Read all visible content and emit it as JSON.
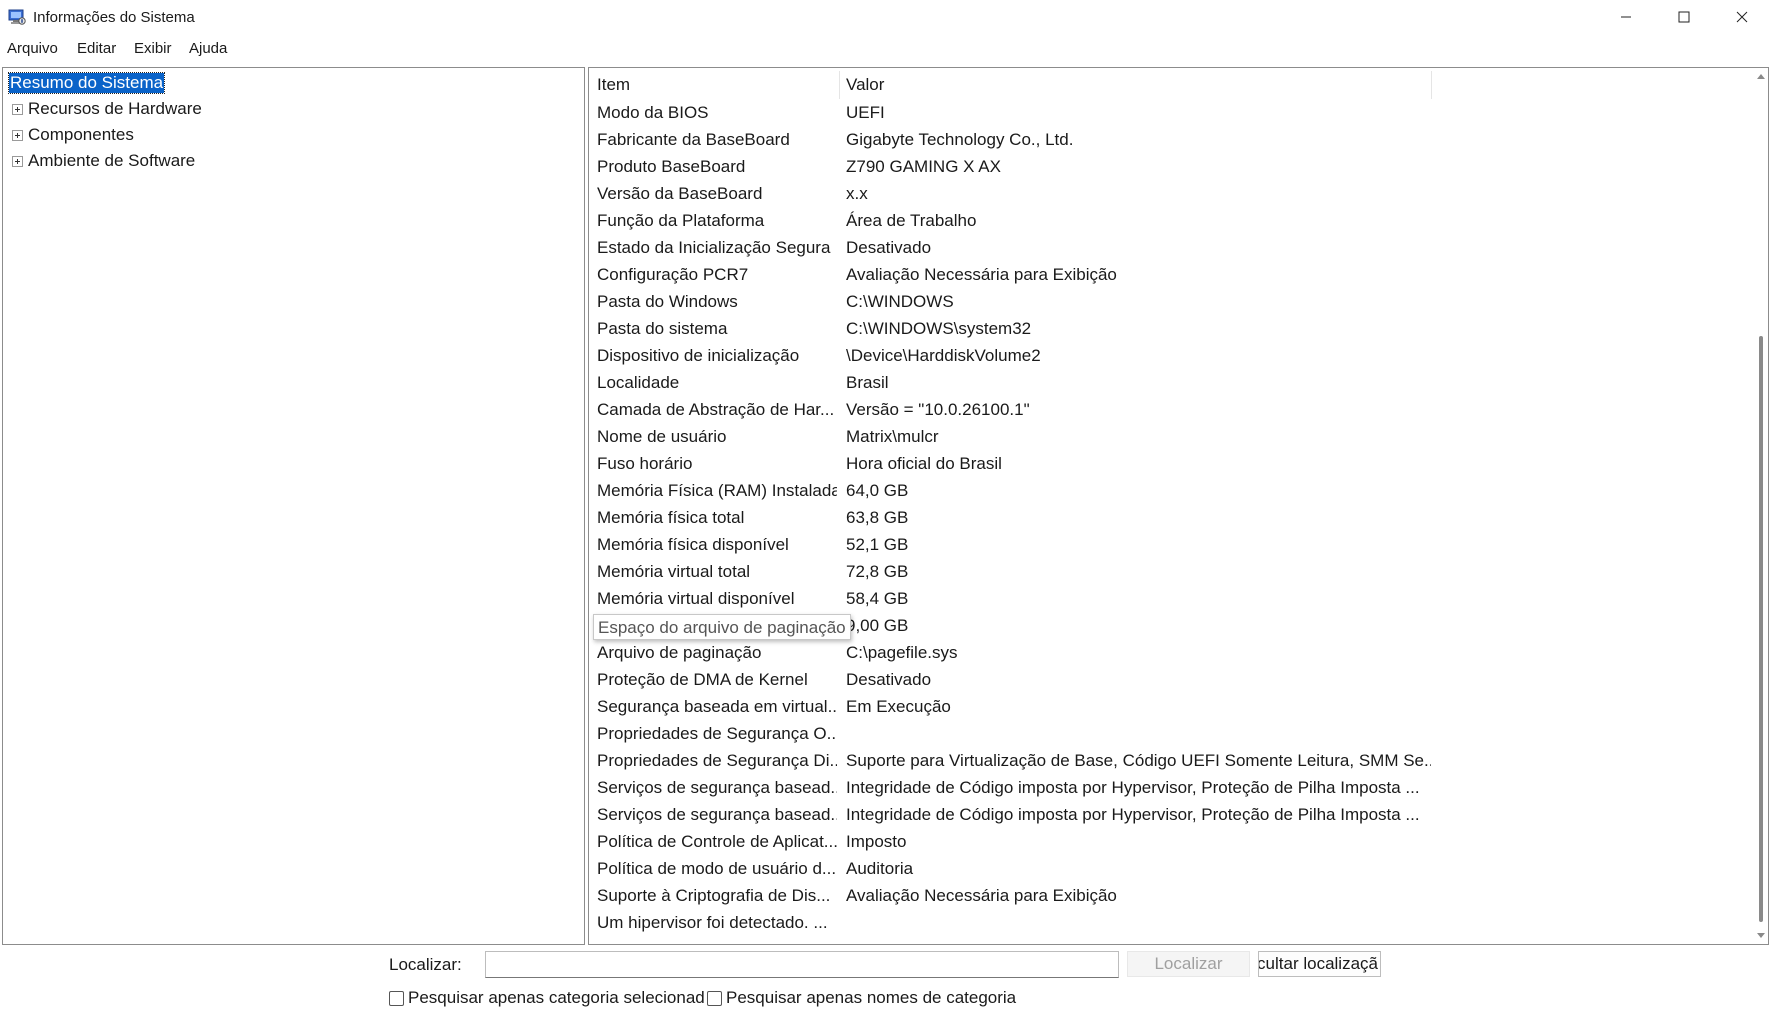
{
  "window": {
    "title": "Informações do Sistema",
    "icon": "system-info-icon"
  },
  "menu": [
    "Arquivo",
    "Editar",
    "Exibir",
    "Ajuda"
  ],
  "tree": {
    "selected": "Resumo do Sistema",
    "nodes": [
      "Recursos de Hardware",
      "Componentes",
      "Ambiente de Software"
    ]
  },
  "list": {
    "headers": {
      "item": "Item",
      "value": "Valor"
    },
    "rows": [
      {
        "item": "Modo da BIOS",
        "value": "UEFI"
      },
      {
        "item": "Fabricante da BaseBoard",
        "value": "Gigabyte Technology Co., Ltd."
      },
      {
        "item": "Produto BaseBoard",
        "value": "Z790 GAMING X AX"
      },
      {
        "item": "Versão da BaseBoard",
        "value": "x.x"
      },
      {
        "item": "Função da Plataforma",
        "value": "Área de Trabalho"
      },
      {
        "item": "Estado da Inicialização Segura",
        "value": "Desativado"
      },
      {
        "item": "Configuração PCR7",
        "value": "Avaliação Necessária para Exibição"
      },
      {
        "item": "Pasta do Windows",
        "value": "C:\\WINDOWS"
      },
      {
        "item": "Pasta do sistema",
        "value": "C:\\WINDOWS\\system32"
      },
      {
        "item": "Dispositivo de inicialização",
        "value": "\\Device\\HarddiskVolume2"
      },
      {
        "item": "Localidade",
        "value": "Brasil"
      },
      {
        "item": "Camada de Abstração de Har...",
        "value": "Versão = \"10.0.26100.1\""
      },
      {
        "item": "Nome de usuário",
        "value": "Matrix\\mulcr"
      },
      {
        "item": "Fuso horário",
        "value": "Hora oficial do Brasil"
      },
      {
        "item": "Memória Física (RAM) Instalada",
        "value": "64,0 GB"
      },
      {
        "item": "Memória física total",
        "value": "63,8 GB"
      },
      {
        "item": "Memória física disponível",
        "value": "52,1 GB"
      },
      {
        "item": "Memória virtual total",
        "value": "72,8 GB"
      },
      {
        "item": "Memória virtual disponível",
        "value": "58,4 GB"
      },
      {
        "item": "Espaço do arquivo de paginação",
        "value": "9,00 GB",
        "tooltip": true
      },
      {
        "item": "Arquivo de paginação",
        "value": "C:\\pagefile.sys"
      },
      {
        "item": "Proteção de DMA de Kernel",
        "value": "Desativado"
      },
      {
        "item": "Segurança baseada em virtual...",
        "value": "Em Execução"
      },
      {
        "item": "Propriedades de Segurança O...",
        "value": ""
      },
      {
        "item": "Propriedades de Segurança Di...",
        "value": "Suporte para Virtualização de Base, Código UEFI Somente Leitura, SMM Se..."
      },
      {
        "item": "Serviços de segurança basead...",
        "value": "Integridade de Código imposta por Hypervisor, Proteção de Pilha Imposta ..."
      },
      {
        "item": "Serviços de segurança basead...",
        "value": "Integridade de Código imposta por Hypervisor, Proteção de Pilha Imposta ..."
      },
      {
        "item": "Política de Controle de Aplicat...",
        "value": "Imposto"
      },
      {
        "item": "Política de modo de usuário d...",
        "value": "Auditoria"
      },
      {
        "item": "Suporte à Criptografia de Dis...",
        "value": "Avaliação Necessária para Exibição"
      },
      {
        "item": "Um hipervisor foi detectado. ...",
        "value": ""
      }
    ]
  },
  "find": {
    "label": "Localizar:",
    "value": "",
    "find_button": "Localizar",
    "clear_button": "cultar localizaçã",
    "checkbox_selected_category": "Pesquisar apenas categoria selecionad",
    "checkbox_category_names": "Pesquisar apenas nomes de categoria"
  },
  "colors": {
    "selection": "#0a63c9",
    "border": "#8c8c8c"
  }
}
